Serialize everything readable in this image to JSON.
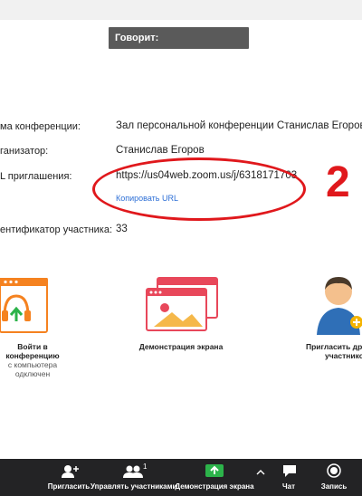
{
  "speaker": {
    "label": "Говорит:"
  },
  "info": {
    "topic_label": "ма конференции:",
    "topic_value": "Зал персональной конференции Станислав Егоров",
    "host_label": "ганизатор:",
    "host_value": "Станислав Егоров",
    "url_label": "L приглашения:",
    "url_value": "https://us04web.zoom.us/j/6318171703",
    "copy_url": "Копировать URL",
    "participant_label": "ентификатор участника:",
    "participant_value": "33"
  },
  "annotation": {
    "number": "2",
    "color": "#e0181c"
  },
  "actions": {
    "join_audio": {
      "line1": "Войти в",
      "line2": "конференцию",
      "line3": "с компьютера",
      "line4": "одключен"
    },
    "share_screen": {
      "label": "Демонстрация экрана"
    },
    "invite": {
      "line1": "Пригласить др",
      "line2": "участнико"
    }
  },
  "toolbar": {
    "invite": "Пригласить",
    "manage": "Управлять участниками",
    "participants_count": "1",
    "share": "Демонстрация экрана",
    "chat": "Чат",
    "record": "Запись"
  },
  "colors": {
    "accent_orange": "#f58220",
    "share_red": "#e8475a",
    "toolbar_bg": "#232325",
    "share_green": "#2cb34a",
    "link_blue": "#2d6fd6"
  }
}
